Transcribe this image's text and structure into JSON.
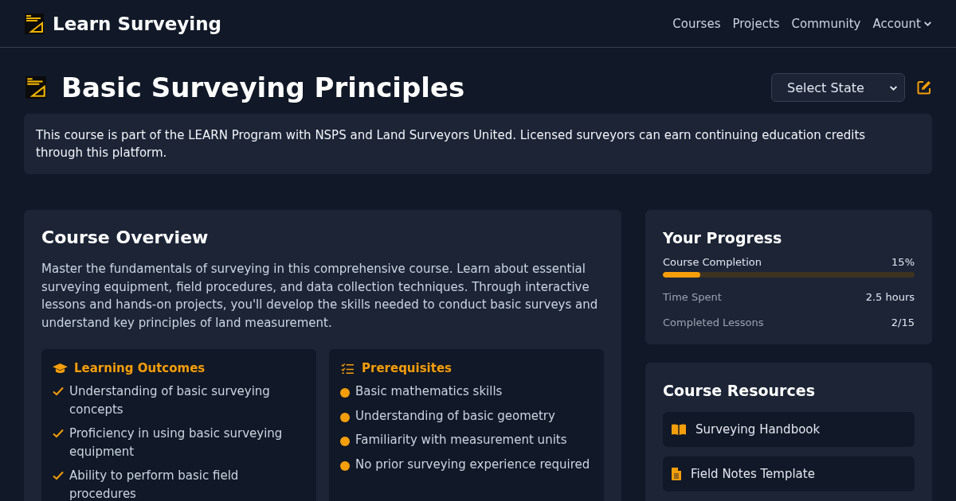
{
  "navbar": {
    "brand": "Learn Surveying",
    "links": [
      {
        "label": "Courses",
        "kind": "link"
      },
      {
        "label": "Projects",
        "kind": "link"
      },
      {
        "label": "Community",
        "kind": "link"
      },
      {
        "label": "Account",
        "kind": "dropdown"
      }
    ]
  },
  "header": {
    "title": "Basic Surveying Principles",
    "state_select": {
      "placeholder": "Select State"
    }
  },
  "notice": "This course is part of the LEARN Program with NSPS and Land Surveyors United. Licensed surveyors can earn continuing education credits through this platform.",
  "overview": {
    "title": "Course Overview",
    "description": "Master the fundamentals of surveying in this comprehensive course. Learn about essential surveying equipment, field procedures, and data collection techniques. Through interactive lessons and hands-on projects, you'll develop the skills needed to conduct basic surveys and understand key principles of land measurement.",
    "panels": [
      {
        "kind": "outcomes",
        "title": "Learning Outcomes",
        "items": [
          "Understanding of basic surveying concepts",
          "Proficiency in using basic surveying equipment",
          "Ability to perform basic field procedures"
        ]
      },
      {
        "kind": "prerequisites",
        "title": "Prerequisites",
        "items": [
          "Basic mathematics skills",
          "Understanding of basic geometry",
          "Familiarity with measurement units",
          "No prior surveying experience required"
        ]
      }
    ]
  },
  "progress": {
    "title": "Your Progress",
    "completion": {
      "label": "Course Completion",
      "value": "15%",
      "level": 0.15
    },
    "stats": [
      {
        "label": "Time Spent",
        "value": "2.5 hours"
      },
      {
        "label": "Completed Lessons",
        "value": "2/15"
      }
    ]
  },
  "resources": {
    "title": "Course Resources",
    "items": [
      {
        "kind": "book",
        "label": "Surveying Handbook"
      },
      {
        "kind": "document",
        "label": "Field Notes Template"
      }
    ]
  }
}
